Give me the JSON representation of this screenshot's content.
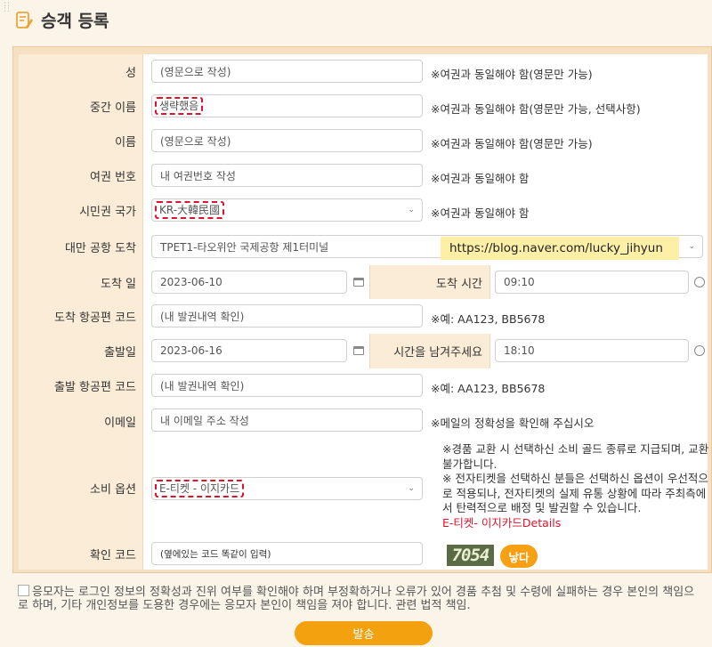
{
  "page": {
    "title": "승객 등록"
  },
  "fields": {
    "surname": {
      "label": "성",
      "placeholder": "(영문으로 작성)",
      "note": "※여권과 동일해야 함(영문만 가능)"
    },
    "middle_name": {
      "label": "중간 이름",
      "value": "생략했음",
      "note": "※여권과 동일해야 함(영문만 가능, 선택사항)"
    },
    "given_name": {
      "label": "이름",
      "placeholder": "(영문으로 작성)",
      "note": "※여권과 동일해야 함(영문만 가능)"
    },
    "passport": {
      "label": "여권 번호",
      "value": "내 여권번호 작성",
      "note": "※여권과 동일해야 함"
    },
    "nationality": {
      "label": "시민권 국가",
      "value": "KR-大韓民國",
      "note": "※여권과 동일해야 함"
    },
    "arrival_airport": {
      "label": "대만 공항 도착",
      "value": "TPET1-타오위안 국제공항 제1터미널",
      "watermark": "https://blog.naver.com/lucky_jihyun"
    },
    "arrival_date": {
      "label": "도착 일",
      "value": "2023-06-10"
    },
    "arrival_time": {
      "label": "도착 시간",
      "value": "09:10"
    },
    "arrival_flight": {
      "label": "도착 항공편 코드",
      "placeholder": "(내 발권내역 확인)",
      "note": "※예: AA123, BB5678"
    },
    "departure_date": {
      "label": "출발일",
      "value": "2023-06-16"
    },
    "departure_time": {
      "label": "시간을 남겨주세요",
      "value": "18:10"
    },
    "departure_flight": {
      "label": "출발 항공편 코드",
      "placeholder": "(내 발권내역 확인)",
      "note": "※예: AA123, BB5678"
    },
    "email": {
      "label": "이메일",
      "value": "내 이메일 주소 작성",
      "note": "※메일의 정확성을 확인해 주십시오"
    },
    "consumption": {
      "label": "소비 옵션",
      "value": "E-티켓 - 이지카드",
      "note1": "※경품 교환 시 선택하신 소비 골드 종류로 지급되며, 교환 불가합니다.",
      "note2": "※ 전자티켓을 선택하신 분들은 선택하신 옵션이 우선적으로 적용되나, 전자티켓의 실제 유통 상황에 따라 주최측에서 탄력적으로 배정 및 발권할 수 있습니다.",
      "link": "E-티켓- 이지카드Details"
    },
    "captcha": {
      "label": "확인 코드",
      "placeholder": "(옆에있는 코드 똑같이 입력)",
      "code": "7054",
      "button": "낳다"
    }
  },
  "agreement": "응모자는 로그인 정보의 정확성과 진위 여부를 확인해야 하며 부정확하거나 오류가 있어 경품 추첨 및 수령에 실패하는 경우 본인의 책임으로 하며, 기타 개인정보를 도용한 경우에는 응모자 본인이 책임을 져야 합니다. 관련 법적 책임.",
  "submit_label": "발송",
  "colors": {
    "accent": "#f3a10f",
    "highlight": "#e0112b",
    "label_bg": "#fbecd7"
  }
}
